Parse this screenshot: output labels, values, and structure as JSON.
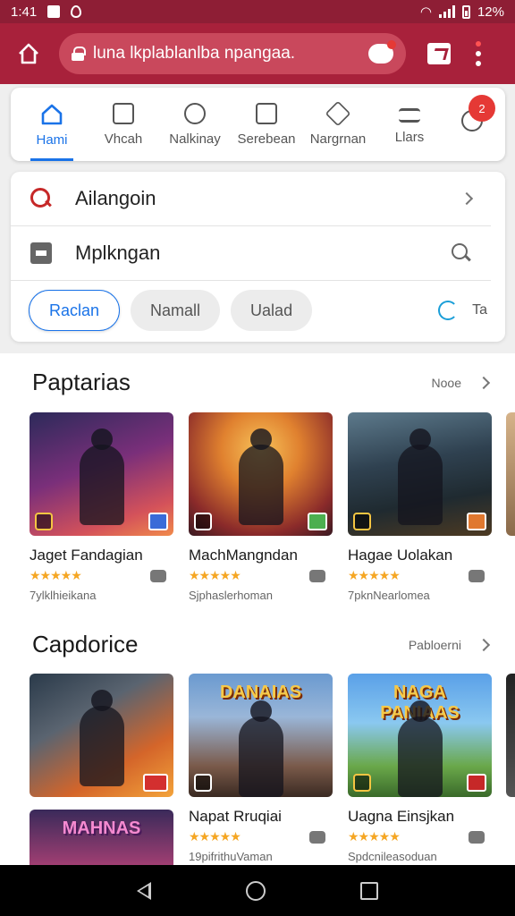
{
  "status": {
    "time": "1:41",
    "battery": "12%"
  },
  "browser": {
    "url": "luna lkplablanlba npangaa."
  },
  "categories": [
    {
      "label": "Hami",
      "icon": "home-icon",
      "active": true
    },
    {
      "label": "Vhcah",
      "icon": "square-icon"
    },
    {
      "label": "Nalkinay",
      "icon": "circle-icon"
    },
    {
      "label": "Serebean",
      "icon": "window-icon"
    },
    {
      "label": "Nargrnan",
      "icon": "diamond-icon"
    },
    {
      "label": "Llars",
      "icon": "list-icon"
    }
  ],
  "category_badge": "2",
  "search": {
    "row1": "Ailangoin",
    "row2": "Mplkngan",
    "chips": [
      "Raclan",
      "Namall",
      "Ualad"
    ],
    "chip_tail": "Ta"
  },
  "sections": [
    {
      "title": "Paptarias",
      "more": "Nooe",
      "games": [
        {
          "name": "Jaget Fandagian",
          "sub": "7ylklhieikana",
          "stars": "★★★★★"
        },
        {
          "name": "MachMangndan",
          "sub": "Sjphaslerhoman",
          "stars": "★★★★★"
        },
        {
          "name": "Hagae Uolakan",
          "sub": "7pknNearlomea",
          "stars": "★★★★★"
        }
      ]
    },
    {
      "title": "Capdorice",
      "more": "Pabloerni",
      "games": [
        {
          "name": "",
          "sub": "",
          "stars": ""
        },
        {
          "name": "Napat Rruqiai",
          "sub": "19pifrithuVaman",
          "stars": "★★★★★",
          "art_title": "DANAIAS"
        },
        {
          "name": "Uagna Einsjkan",
          "sub": "Spdcnileasoduan",
          "stars": "★★★★★",
          "art_title": "NAGA PANIAAS"
        }
      ],
      "extra_art_title": "MAHNAS"
    }
  ],
  "colors": {
    "brand": "#a8213b",
    "status_bar": "#8e1e35",
    "accent": "#1a73e8",
    "star": "#f5a623"
  }
}
